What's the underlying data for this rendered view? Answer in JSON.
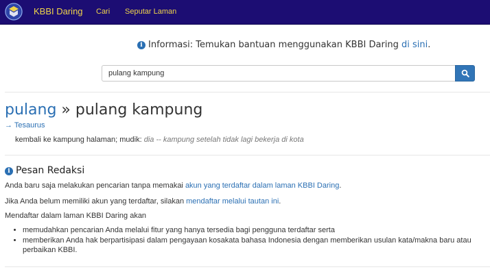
{
  "navbar": {
    "brand": "KBBI Daring",
    "links": [
      "Cari",
      "Seputar Laman"
    ]
  },
  "info": {
    "prefix": "Informasi: Temukan bantuan menggunakan KBBI Daring ",
    "link": "di sini",
    "suffix": "."
  },
  "search": {
    "value": "pulang kampung"
  },
  "entry": {
    "root": "pulang",
    "separator": " » ",
    "headword": "pulang kampung",
    "thesaurus_link": "→ Tesaurus",
    "definition": "kembali ke kampung halaman; mudik: ",
    "example": "dia -- kampung setelah tidak lagi bekerja di kota"
  },
  "message": {
    "heading": "Pesan Redaksi",
    "p1_text": "Anda baru saja melakukan pencarian tanpa memakai ",
    "p1_link": "akun yang terdaftar dalam laman KBBI Daring",
    "p1_end": ".",
    "p2_text": "Jika Anda belum memiliki akun yang terdaftar, silakan ",
    "p2_link": "mendaftar melalui tautan ini",
    "p2_end": ".",
    "p3_text": "Mendaftar dalam laman KBBI Daring akan",
    "bullets": [
      "memudahkan pencarian Anda melalui fitur yang hanya tersedia bagi pengguna terdaftar serta",
      "memberikan Anda hak berpartisipasi dalam pengayaan kosakata bahasa Indonesia dengan memberikan usulan kata/makna baru atau perbaikan KBBI."
    ]
  },
  "colors": {
    "navbar_bg": "#1c0d73",
    "navbar_text": "#f0d44a",
    "link": "#2a6fb3",
    "search_button": "#3175b7"
  },
  "icons": [
    "logo-emblem",
    "info-icon",
    "search-icon",
    "info-icon"
  ]
}
